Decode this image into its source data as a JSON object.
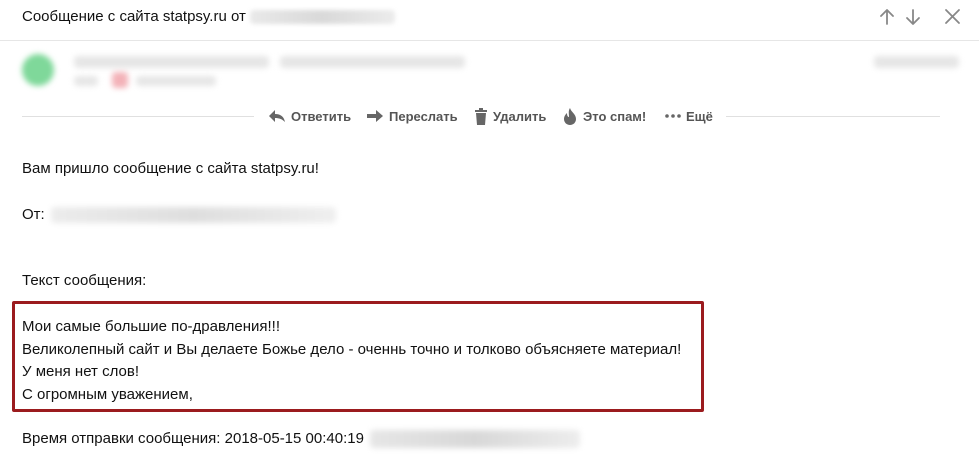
{
  "header": {
    "subject": "Сообщение с сайта statpsy.ru от",
    "sender_email_hidden": "blurred"
  },
  "actions": {
    "reply": "Ответить",
    "forward": "Переслать",
    "delete": "Удалить",
    "spam": "Это спам!",
    "more": "Ещё"
  },
  "message": {
    "intro": "Вам пришло сообщение с сайта statpsy.ru!",
    "from_label": "От:",
    "text_label": "Текст сообщения:",
    "lines": [
      "Мои самые большие по-дравления!!!",
      "Великолепный сайт и Вы делаете Божье дело -  оченнь точно и толково объясняете материал!",
      "У меня нет слов!",
      "С огромным уважением,"
    ],
    "sent_time": "Время отправки сообщения: 2018-05-15 00:40:19"
  },
  "colors": {
    "highlight_border": "#9b1b1e",
    "toolbar_text": "#555555",
    "icon_color": "#666666"
  },
  "icons": [
    "arrow-up-icon",
    "arrow-down-icon",
    "close-icon",
    "reply-icon",
    "forward-icon",
    "trash-icon",
    "fire-icon",
    "more-dots-icon"
  ]
}
